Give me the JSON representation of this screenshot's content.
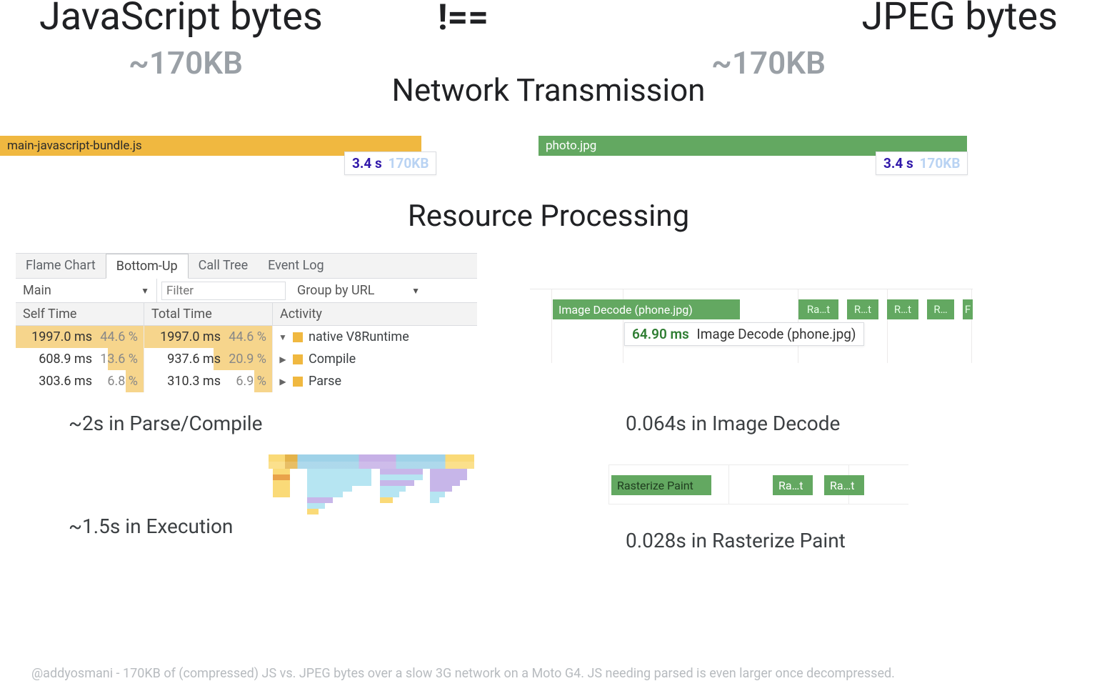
{
  "headline": {
    "js": "JavaScript bytes",
    "neq": "!==",
    "jpeg": "JPEG bytes"
  },
  "sizes": {
    "left": "~170KB",
    "right": "~170KB"
  },
  "section1": "Network Transmission",
  "network": {
    "js": {
      "label": "main-javascript-bundle.js",
      "time": "3.4 s",
      "kb": "170KB"
    },
    "jpg": {
      "label": "photo.jpg",
      "time": "3.4 s",
      "kb": "170KB"
    }
  },
  "section2": "Resource Processing",
  "devtools": {
    "tabs": [
      "Flame Chart",
      "Bottom-Up",
      "Call Tree",
      "Event Log"
    ],
    "active_tab": 1,
    "main_dd": "Main",
    "filter_placeholder": "Filter",
    "group_dd": "Group by URL",
    "cols": [
      "Self Time",
      "Total Time",
      "Activity"
    ],
    "rows": [
      {
        "self_ms": "1997.0 ms",
        "self_pct": "44.6 %",
        "self_bar": 100,
        "total_ms": "1997.0 ms",
        "total_pct": "44.6 %",
        "total_bar": 100,
        "toggle": "down",
        "activity": "native V8Runtime"
      },
      {
        "self_ms": "608.9 ms",
        "self_pct": "13.6 %",
        "self_bar": 28,
        "total_ms": "937.6 ms",
        "total_pct": "20.9 %",
        "total_bar": 46,
        "toggle": "right",
        "activity": "Compile"
      },
      {
        "self_ms": "303.6 ms",
        "self_pct": "6.8 %",
        "self_bar": 14,
        "total_ms": "310.3 ms",
        "total_pct": "6.9 %",
        "total_bar": 14,
        "toggle": "right",
        "activity": "Parse"
      }
    ]
  },
  "decode": {
    "main_label": "Image Decode (phone.jpg)",
    "tiny": [
      "Ra…t",
      "R…t",
      "R…t",
      "R…",
      "F"
    ],
    "tooltip_ms": "64.90 ms",
    "tooltip_label": "Image Decode (phone.jpg)"
  },
  "raster": {
    "labels": [
      "Rasterize Paint",
      "Ra…t",
      "Ra…t"
    ]
  },
  "callouts": {
    "parse": "~2s in Parse/Compile",
    "exec": "~1.5s in Execution",
    "decode": "0.064s in Image Decode",
    "raster": "0.028s in Rasterize Paint"
  },
  "footnote": "@addyosmani - 170KB of (compressed) JS vs. JPEG bytes over a slow 3G network on a Moto G4. JS needing parsed is even larger once decompressed."
}
